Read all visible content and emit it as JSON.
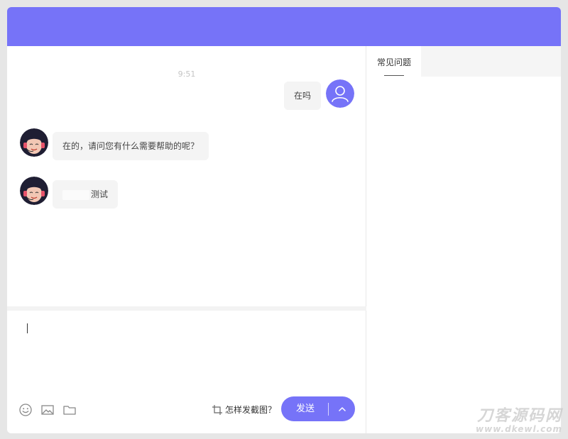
{
  "chat": {
    "timestamp": "9:51",
    "messages": [
      {
        "sender": "user",
        "text": "在吗"
      },
      {
        "sender": "agent",
        "text": "在的，请问您有什么需要帮助的呢？"
      },
      {
        "sender": "agent",
        "text": "测试"
      }
    ]
  },
  "composer": {
    "screenshot_tip": "怎样发截图？",
    "send_label": "发送",
    "icons": [
      "emoji-icon",
      "image-icon",
      "folder-icon",
      "crop-icon",
      "chevron-up-icon"
    ]
  },
  "sidebar": {
    "tabs": [
      {
        "label": "常见问题",
        "active": true
      }
    ]
  },
  "watermark": {
    "logo_text": "刀客源码网",
    "url": "www.dkewl.com"
  },
  "colors": {
    "accent": "#7673f8",
    "bubble": "#f4f4f4",
    "background": "#e6e6e6"
  }
}
